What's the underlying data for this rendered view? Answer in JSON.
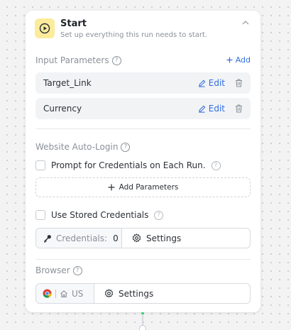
{
  "node": {
    "title": "Start",
    "subtitle": "Set up everything this run needs to start."
  },
  "input_parameters": {
    "label": "Input Parameters",
    "add_label": "Add",
    "items": [
      {
        "name": "Target_Link",
        "edit_label": "Edit"
      },
      {
        "name": "Currency",
        "edit_label": "Edit"
      }
    ]
  },
  "auto_login": {
    "label": "Website Auto-Login",
    "prompt_label": "Prompt for Credentials on Each Run.",
    "add_params_label": "Add Parameters",
    "stored_label": "Use Stored Credentials",
    "credentials_label": "Credentials:",
    "credentials_count": "0",
    "settings_label": "Settings"
  },
  "browser": {
    "label": "Browser",
    "region": "US",
    "settings_label": "Settings"
  },
  "colors": {
    "accent": "#2f6ee0",
    "start_icon_bg": "#fbeb9a",
    "connector_active": "#3cd278"
  },
  "icons": {
    "start": "play-circle-icon",
    "collapse": "chevron-up-icon",
    "edit": "pencil-icon",
    "delete": "trash-icon",
    "add": "plus-icon",
    "key": "key-icon",
    "settings": "gear-icon",
    "browser": "chrome-icon",
    "home": "home-icon",
    "help": "question-circle-icon"
  }
}
